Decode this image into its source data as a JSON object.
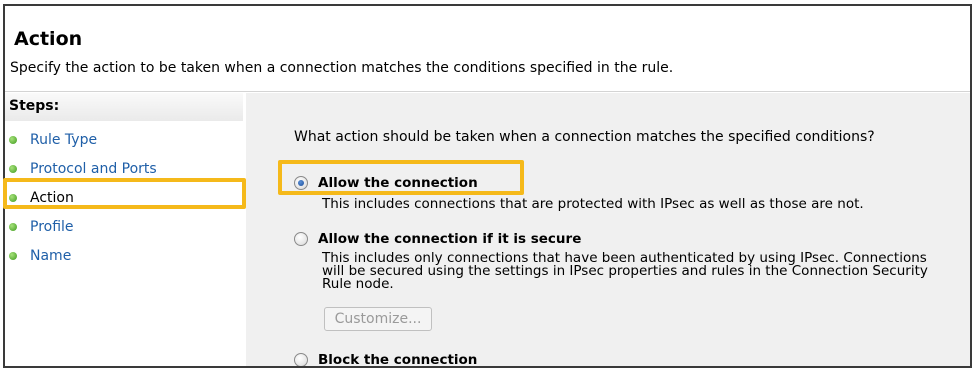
{
  "header": {
    "title": "Action",
    "description": "Specify the action to be taken when a connection matches the conditions specified in the rule."
  },
  "sidebar": {
    "steps_label": "Steps:",
    "items": [
      {
        "label": "Rule Type"
      },
      {
        "label": "Protocol and Ports"
      },
      {
        "label": "Action",
        "current": true
      },
      {
        "label": "Profile"
      },
      {
        "label": "Name"
      }
    ]
  },
  "content": {
    "question": "What action should be taken when a connection matches the specified conditions?",
    "options": [
      {
        "label": "Allow the connection",
        "selected": true,
        "description": "This includes connections that are protected with IPsec as well as those are not."
      },
      {
        "label": "Allow the connection if it is secure",
        "selected": false,
        "description_lines": [
          "This includes only connections that have been authenticated by using IPsec.  Connections",
          "will be secured using the settings in IPsec properties and rules in the Connection Security",
          "Rule node."
        ],
        "button_label": "Customize..."
      },
      {
        "label": "Block the connection",
        "selected": false
      }
    ]
  },
  "colors": {
    "highlight": "#f5b91a",
    "link": "#1f5fa8",
    "panel_bg": "#f0f0f0"
  }
}
